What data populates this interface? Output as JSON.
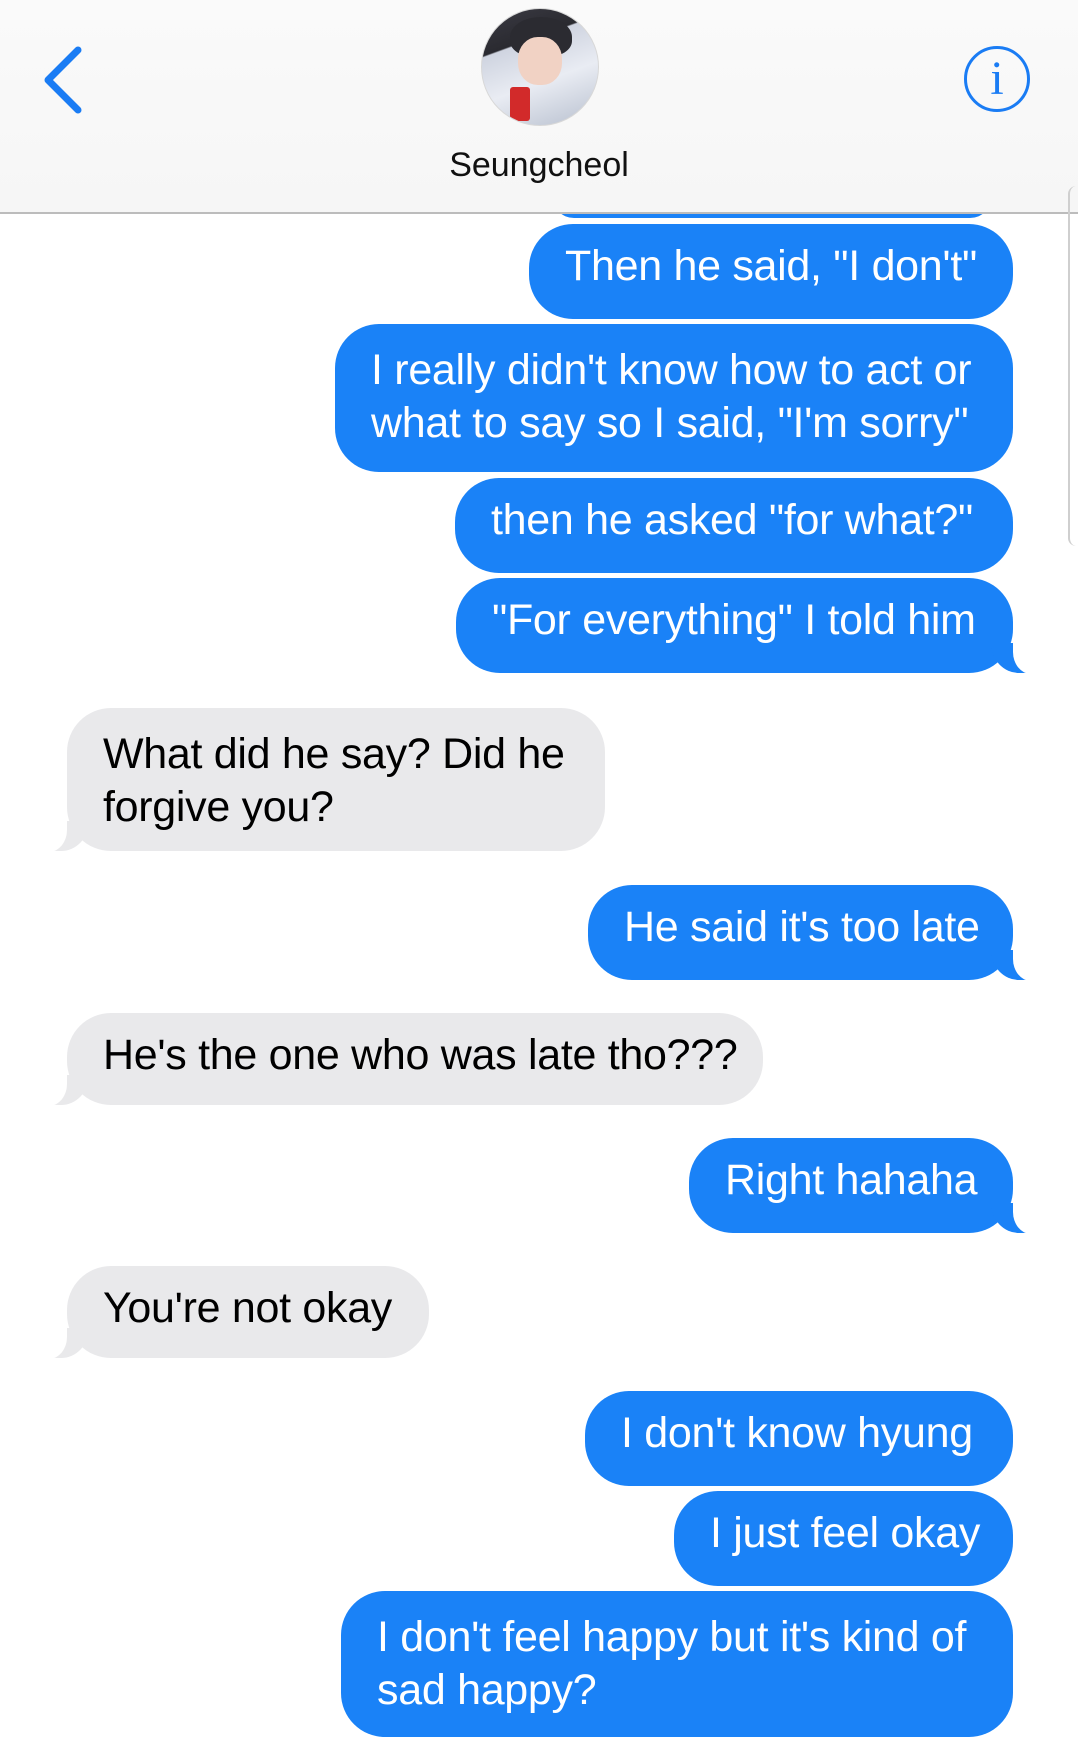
{
  "header": {
    "contact_name": "Seungcheol",
    "info_label": "i"
  },
  "colors": {
    "sent_bubble": "#1a82f7",
    "received_bubble": "#e9e9eb",
    "accent": "#1a7cf4"
  },
  "icons": {
    "back": "chevron-left-icon",
    "info": "info-icon"
  },
  "messages": [
    {
      "direction": "sent",
      "text": "Then he said, \"I don't\""
    },
    {
      "direction": "sent",
      "text": "I really didn't know how to act or what to say so I said, \"I'm sorry\""
    },
    {
      "direction": "sent",
      "text": "then he asked \"for what?\""
    },
    {
      "direction": "sent",
      "text": "\"For everything\" I told him"
    },
    {
      "direction": "received",
      "text": "What did he say? Did he forgive you?"
    },
    {
      "direction": "sent",
      "text": "He said it's too late"
    },
    {
      "direction": "received",
      "text": "He's the one who was late tho???"
    },
    {
      "direction": "sent",
      "text": "Right hahaha"
    },
    {
      "direction": "received",
      "text": "You're not okay"
    },
    {
      "direction": "sent",
      "text": "I don't know hyung"
    },
    {
      "direction": "sent",
      "text": "I just feel okay"
    },
    {
      "direction": "sent",
      "text": "I don't feel happy but it's kind of sad happy?"
    }
  ]
}
